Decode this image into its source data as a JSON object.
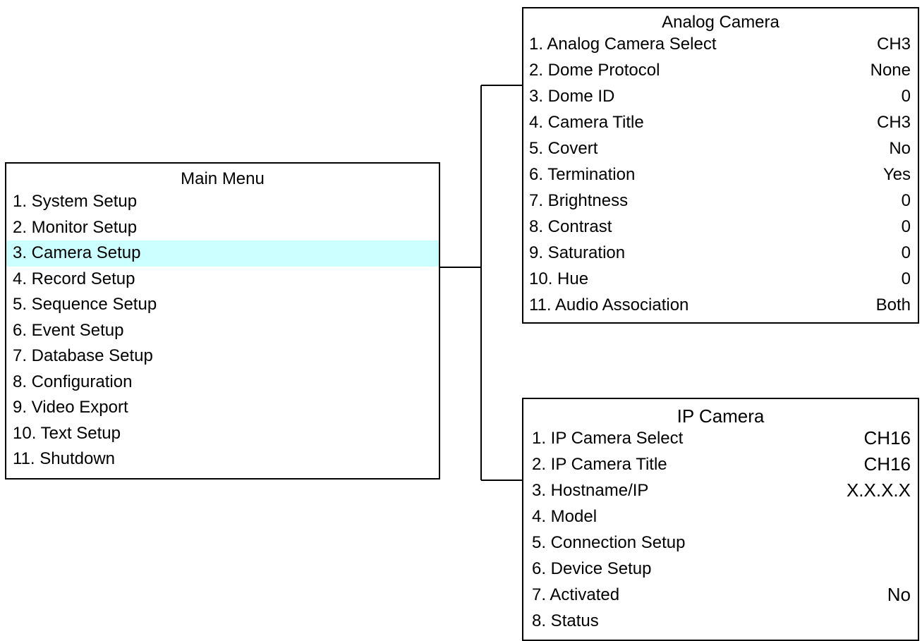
{
  "main_menu": {
    "title": "Main Menu",
    "items": [
      {
        "label": "1. System Setup"
      },
      {
        "label": "2. Monitor Setup"
      },
      {
        "label": "3. Camera Setup",
        "highlighted": true
      },
      {
        "label": "4. Record Setup"
      },
      {
        "label": "5. Sequence Setup"
      },
      {
        "label": "6. Event Setup"
      },
      {
        "label": "7. Database Setup"
      },
      {
        "label": "8. Configuration"
      },
      {
        "label": "9. Video Export"
      },
      {
        "label": "10. Text Setup"
      },
      {
        "label": "11. Shutdown"
      }
    ],
    "highlight_color": "#ccffff"
  },
  "analog_camera": {
    "title": "Analog Camera",
    "items": [
      {
        "label": "1. Analog Camera Select",
        "value": "CH3"
      },
      {
        "label": "2. Dome Protocol",
        "value": "None"
      },
      {
        "label": "3. Dome ID",
        "value": "0"
      },
      {
        "label": "4. Camera Title",
        "value": "CH3"
      },
      {
        "label": "5. Covert",
        "value": "No"
      },
      {
        "label": "6. Termination",
        "value": "Yes"
      },
      {
        "label": "7. Brightness",
        "value": "0"
      },
      {
        "label": "8. Contrast",
        "value": "0"
      },
      {
        "label": "9. Saturation",
        "value": "0"
      },
      {
        "label": "10. Hue",
        "value": "0"
      },
      {
        "label": "11. Audio Association",
        "value": "Both"
      }
    ]
  },
  "ip_camera": {
    "title": "IP Camera",
    "items": [
      {
        "label": "1. IP Camera Select",
        "value": "CH16"
      },
      {
        "label": "2. IP Camera Title",
        "value": "CH16"
      },
      {
        "label": "3. Hostname/IP",
        "value": "X.X.X.X"
      },
      {
        "label": "4. Model",
        "value": ""
      },
      {
        "label": "5. Connection Setup",
        "value": ""
      },
      {
        "label": "6. Device Setup",
        "value": ""
      },
      {
        "label": "7. Activated",
        "value": "No"
      },
      {
        "label": "8. Status",
        "value": ""
      }
    ]
  }
}
